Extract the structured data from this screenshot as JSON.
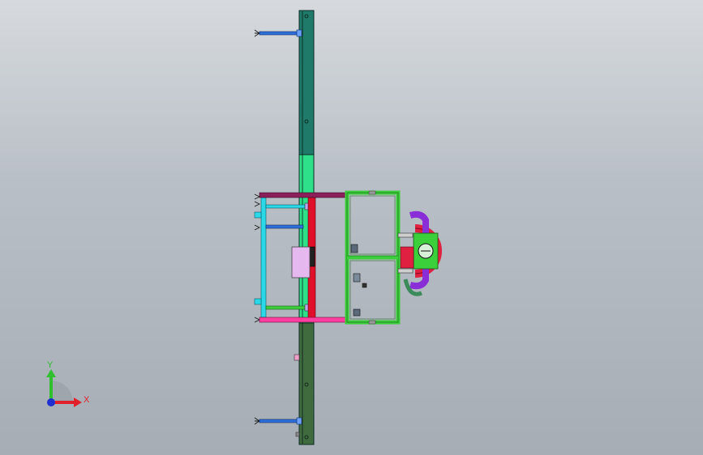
{
  "view": {
    "background_top": "#d6dade",
    "background_bottom": "#a6adb5"
  },
  "triad": {
    "x_label": "X",
    "y_label": "Y",
    "x_color": "#e0202a",
    "y_color": "#2fbf2f",
    "z_color": "#1f2fd0"
  },
  "colors": {
    "beam_top": "#1f7a6a",
    "beam_mid": "#2ee08a",
    "beam_bottom": "#3f6b3f",
    "frame_cyan": "#2ad8e8",
    "frame_green": "#3ccf3c",
    "frame_red": "#e0102a",
    "frame_pink": "#ff3fa0",
    "frame_maroon": "#8a1f5a",
    "rod_blue": "#2f6fd8",
    "pipe_purple": "#8a2fd8",
    "pump_red": "#e02040",
    "box_lilac": "#e6b8f0"
  }
}
